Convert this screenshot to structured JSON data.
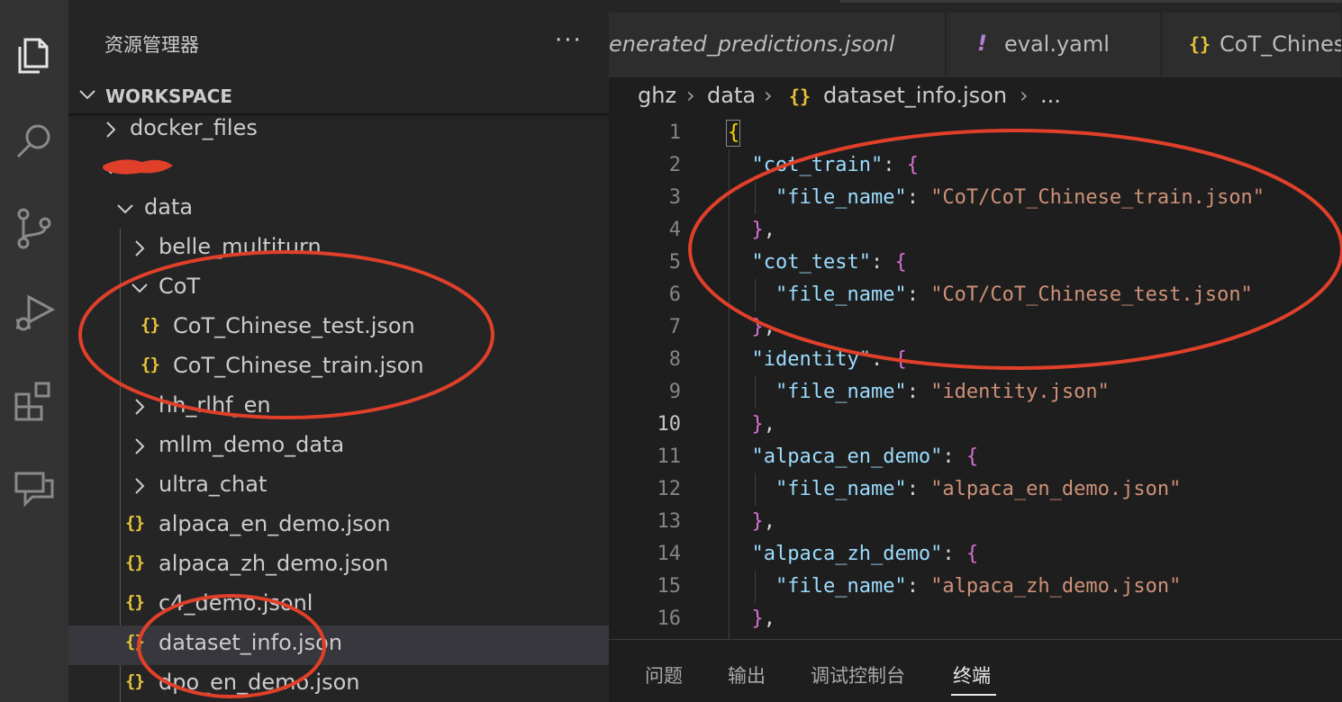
{
  "explorer": {
    "title": "资源管理器",
    "more": "···",
    "workspace_label": "WORKSPACE",
    "items": [
      {
        "label": "docker_files",
        "kind": "folder",
        "state": "collapsed"
      },
      {
        "label": "",
        "kind": "folder",
        "state": "expanded"
      },
      {
        "label": "data",
        "kind": "folder",
        "state": "expanded"
      },
      {
        "label": "belle_multiturn",
        "kind": "folder",
        "state": "collapsed"
      },
      {
        "label": "CoT",
        "kind": "folder",
        "state": "expanded"
      },
      {
        "label": "CoT_Chinese_test.json",
        "kind": "json"
      },
      {
        "label": "CoT_Chinese_train.json",
        "kind": "json"
      },
      {
        "label": "hh_rlhf_en",
        "kind": "folder",
        "state": "collapsed"
      },
      {
        "label": "mllm_demo_data",
        "kind": "folder",
        "state": "collapsed"
      },
      {
        "label": "ultra_chat",
        "kind": "folder",
        "state": "collapsed"
      },
      {
        "label": "alpaca_en_demo.json",
        "kind": "json"
      },
      {
        "label": "alpaca_zh_demo.json",
        "kind": "json"
      },
      {
        "label": "c4_demo.jsonl",
        "kind": "json"
      },
      {
        "label": "dataset_info.json",
        "kind": "json",
        "selected": true
      },
      {
        "label": "dpo_en_demo.json",
        "kind": "json"
      }
    ]
  },
  "tabs": [
    {
      "label": "enerated_predictions.jsonl",
      "icon": ""
    },
    {
      "label": "eval.yaml",
      "icon": "!"
    },
    {
      "label": "CoT_Chines",
      "icon": "{}"
    }
  ],
  "breadcrumb": [
    "ghz",
    "data",
    "dataset_info.json",
    "..."
  ],
  "breadcrumb_icon": "{}",
  "json_icon": "{}",
  "editor": {
    "active_line": 10,
    "line_numbers": [
      "1",
      "2",
      "3",
      "4",
      "5",
      "6",
      "7",
      "8",
      "9",
      "10",
      "11",
      "12",
      "13",
      "14",
      "15",
      "16"
    ],
    "keys": {
      "cot_train": "\"cot_train\"",
      "cot_test": "\"cot_test\"",
      "identity": "\"identity\"",
      "alpaca_en_demo": "\"alpaca_en_demo\"",
      "alpaca_zh_demo": "\"alpaca_zh_demo\"",
      "file_name": "\"file_name\""
    },
    "values": {
      "cot_train": "\"CoT/CoT_Chinese_train.json\"",
      "cot_test": "\"CoT/CoT_Chinese_test.json\"",
      "identity": "\"identity.json\"",
      "alpaca_en_demo": "\"alpaca_en_demo.json\"",
      "alpaca_zh_demo": "\"alpaca_zh_demo.json\""
    }
  },
  "panel": {
    "tabs": [
      "问题",
      "输出",
      "调试控制台",
      "终端"
    ],
    "active": "终端"
  },
  "colors": {
    "accent_annotation": "#e0402a",
    "json_icon": "#e8c43a",
    "yaml_icon": "#b180d7"
  }
}
